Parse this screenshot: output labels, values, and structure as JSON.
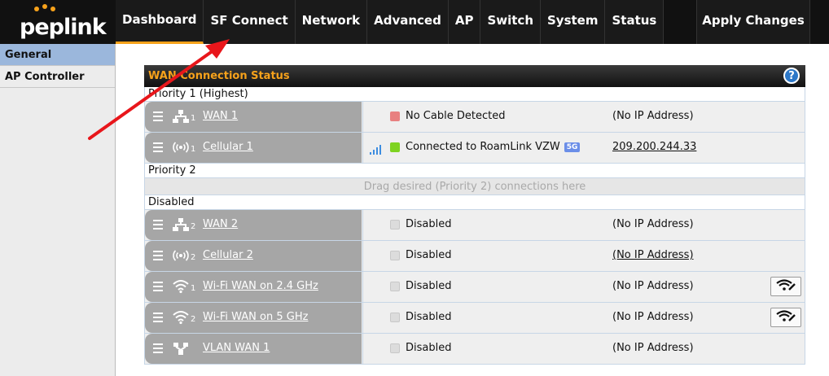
{
  "logo": {
    "text": "peplink"
  },
  "nav": {
    "items": [
      "Dashboard",
      "SF Connect",
      "Network",
      "Advanced",
      "AP",
      "Switch",
      "System",
      "Status"
    ],
    "apply": "Apply Changes",
    "active_index": 0
  },
  "sidebar": {
    "items": [
      {
        "label": "General",
        "active": true
      },
      {
        "label": "AP Controller",
        "active": false
      }
    ]
  },
  "panel": {
    "title": "WAN Connection Status",
    "help": "?",
    "groups": {
      "priority1": "Priority 1 (Highest)",
      "priority2": "Priority 2",
      "disabled": "Disabled",
      "drop_hint": "Drag desired (Priority 2) connections here"
    },
    "rows": [
      {
        "icon": "ethernet-icon",
        "num": "1",
        "name": "WAN 1",
        "status": "No Cable Detected",
        "status_color": "#e88080",
        "ip": "(No IP Address)",
        "ip_link": false,
        "signal": false,
        "badge": "",
        "wifi_button": false
      },
      {
        "icon": "cellular-icon",
        "num": "1",
        "name": "Cellular 1",
        "status": "Connected to RoamLink VZW",
        "status_color": "#7ed321",
        "ip": "209.200.244.33",
        "ip_link": true,
        "signal": true,
        "badge": "5G",
        "wifi_button": false
      },
      {
        "icon": "ethernet-icon",
        "num": "2",
        "name": "WAN 2",
        "status": "Disabled",
        "status_color": "#dcdcdc",
        "ip": "(No IP Address)",
        "ip_link": false,
        "signal": false,
        "badge": "",
        "wifi_button": false
      },
      {
        "icon": "cellular-icon",
        "num": "2",
        "name": "Cellular 2",
        "status": "Disabled",
        "status_color": "#dcdcdc",
        "ip": "(No IP Address)",
        "ip_link": true,
        "signal": false,
        "badge": "",
        "wifi_button": false
      },
      {
        "icon": "wifi-icon",
        "num": "1",
        "name": "Wi-Fi WAN on 2.4 GHz",
        "status": "Disabled",
        "status_color": "#dcdcdc",
        "ip": "(No IP Address)",
        "ip_link": false,
        "signal": false,
        "badge": "",
        "wifi_button": true
      },
      {
        "icon": "wifi-icon",
        "num": "2",
        "name": "Wi-Fi WAN on 5 GHz",
        "status": "Disabled",
        "status_color": "#dcdcdc",
        "ip": "(No IP Address)",
        "ip_link": false,
        "signal": false,
        "badge": "",
        "wifi_button": true
      },
      {
        "icon": "vlan-icon",
        "num": "",
        "name": "VLAN WAN 1",
        "status": "Disabled",
        "status_color": "#dcdcdc",
        "ip": "(No IP Address)",
        "ip_link": false,
        "signal": false,
        "badge": "",
        "wifi_button": false
      }
    ]
  },
  "colors": {
    "accent": "#f7a21b",
    "active_sidebar": "#9bb7dc",
    "arrow": "#e8161b"
  }
}
